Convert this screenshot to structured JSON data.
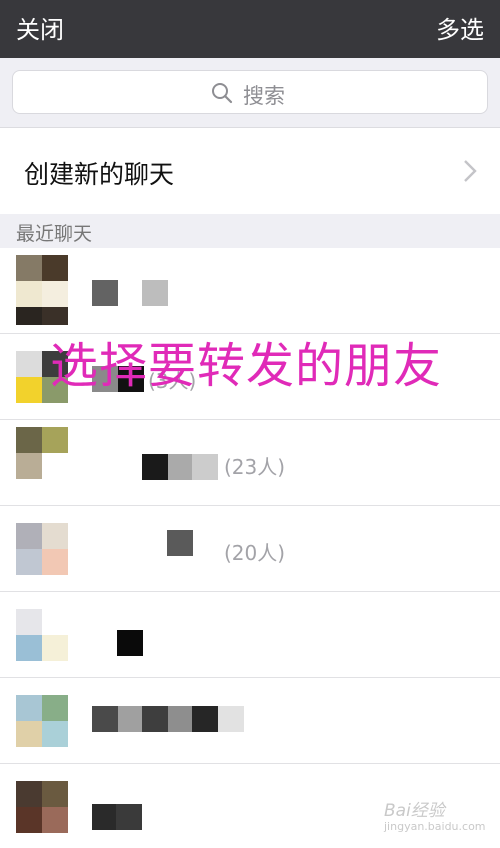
{
  "topbar": {
    "close_label": "关闭",
    "multi_select_label": "多选"
  },
  "search": {
    "placeholder": "搜索"
  },
  "new_chat": {
    "label": "创建新的聊天"
  },
  "section": {
    "recent_label": "最近聊天"
  },
  "chats": [
    {
      "count": ""
    },
    {
      "count": "(3人)"
    },
    {
      "count": "(23人)"
    },
    {
      "count": "(20人)"
    },
    {
      "count": ""
    },
    {
      "count": ""
    },
    {
      "count": ""
    }
  ],
  "overlay": {
    "text": "选择要转发的朋友"
  },
  "watermark": {
    "brand": "Bai经验",
    "site": "jingyan.baidu.com"
  },
  "colors": {
    "topbar": "#38383c",
    "overlay": "#e02ab8",
    "section_bg": "#efeff4"
  },
  "icons": {
    "search": "search-icon",
    "chevron": "chevron-right-icon"
  }
}
